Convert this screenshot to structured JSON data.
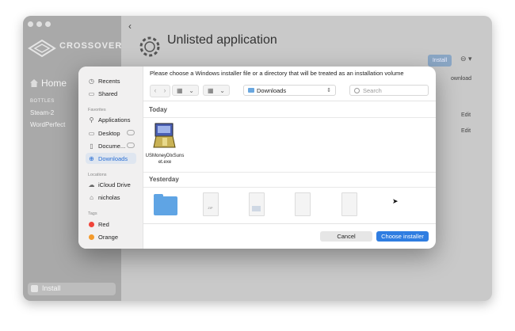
{
  "app": {
    "brand": "CROSSOVER",
    "home": "Home",
    "bottles_header": "BOTTLES",
    "bottles": [
      "Steam-2",
      "WordPerfect"
    ],
    "install": "Install",
    "title": "Unlisted application",
    "install_button": "Install",
    "download_text": "ownload",
    "edit_labels": [
      "Edit",
      "Edit"
    ]
  },
  "dialog": {
    "prompt": "Please choose a Windows installer file or a directory that will be treated as an installation volume",
    "location": "Downloads",
    "search_placeholder": "Search",
    "sidebar": {
      "top_items": [
        {
          "label": "Recents",
          "icon": "clock-icon"
        },
        {
          "label": "Shared",
          "icon": "shared-folder-icon"
        }
      ],
      "favorites_header": "Favorites",
      "favorites": [
        {
          "label": "Applications",
          "icon": "applications-icon"
        },
        {
          "label": "Desktop",
          "icon": "desktop-icon"
        },
        {
          "label": "Docume...",
          "icon": "document-icon"
        },
        {
          "label": "Downloads",
          "icon": "download-icon"
        }
      ],
      "locations_header": "Locations",
      "locations": [
        {
          "label": "iCloud Drive",
          "icon": "cloud-icon"
        },
        {
          "label": "nicholas",
          "icon": "home-icon"
        }
      ],
      "tags_header": "Tags",
      "tags": [
        {
          "label": "Red",
          "color": "#f0443a"
        },
        {
          "label": "Orange",
          "color": "#f39a2c"
        }
      ]
    },
    "groups": [
      {
        "header": "Today",
        "files": [
          {
            "name": "USMoneyDlxSunset.exe",
            "line1": "USMoneyDlxSuns",
            "line2": "et.exe"
          }
        ]
      },
      {
        "header": "Yesterday"
      }
    ],
    "cancel": "Cancel",
    "choose": "Choose installer"
  },
  "colors": {
    "accent": "#2f7de1",
    "selection": "#dfe6f0"
  }
}
